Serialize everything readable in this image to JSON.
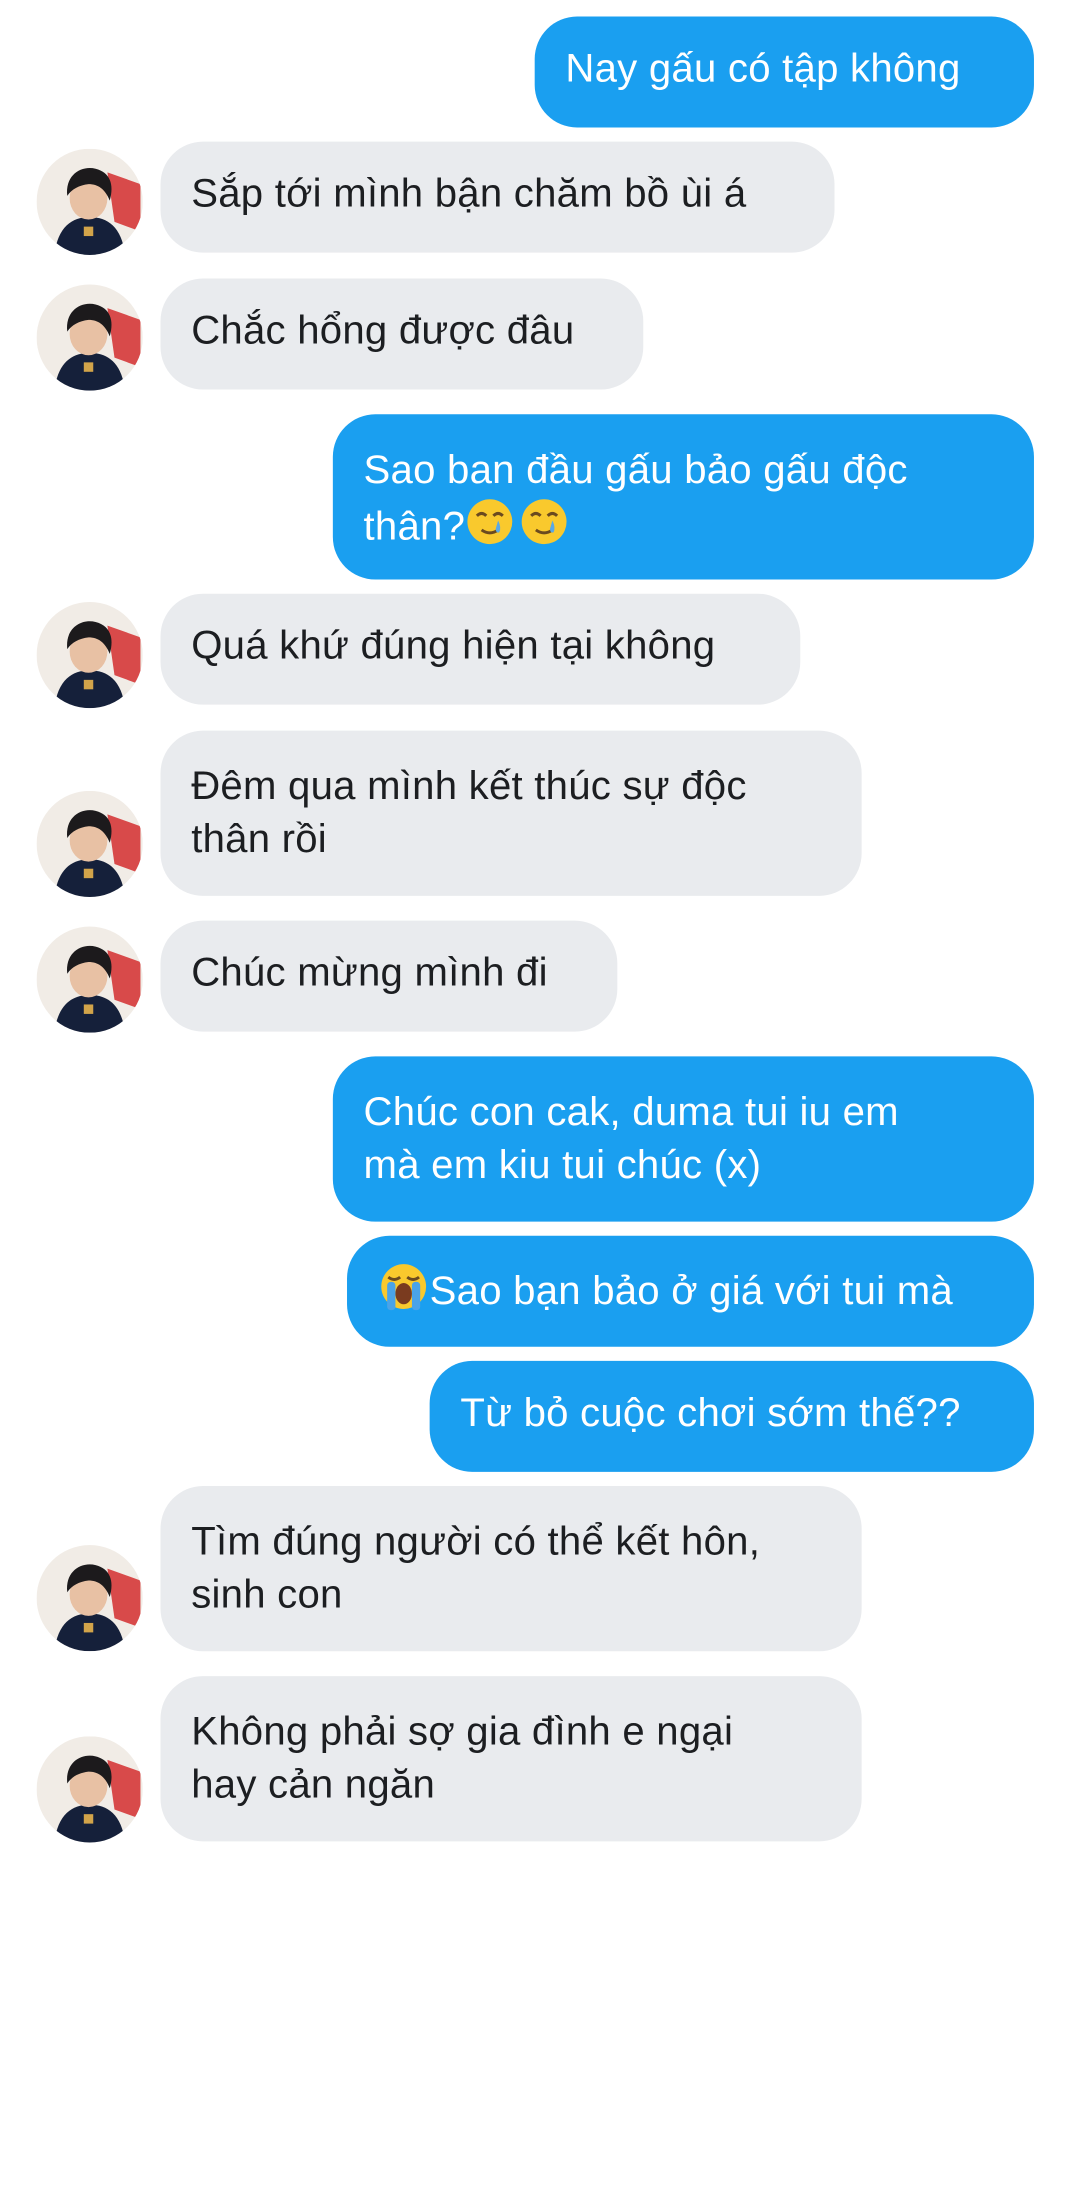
{
  "conversation": {
    "messages": [
      {
        "sender": "me",
        "lines": [
          "Nay gấu có tập không"
        ]
      },
      {
        "sender": "them",
        "lines": [
          "Sắp tới mình bận chăm bồ ùi á"
        ]
      },
      {
        "sender": "them",
        "lines": [
          "Chắc hổng được đâu"
        ]
      },
      {
        "sender": "me",
        "lines": [
          "Sao ban đầu gấu bảo gấu độc",
          "thân?"
        ],
        "emoji": "🥲🥲"
      },
      {
        "sender": "them",
        "lines": [
          "Quá khứ đúng hiện tại không"
        ]
      },
      {
        "sender": "them",
        "lines": [
          "Đêm qua mình kết thúc sự độc",
          "thân rồi"
        ]
      },
      {
        "sender": "them",
        "lines": [
          "Chúc mừng mình đi"
        ]
      },
      {
        "sender": "me",
        "lines": [
          "Chúc con cak, duma tui iu em",
          "mà em kiu tui chúc (x)"
        ]
      },
      {
        "sender": "me",
        "lines": [
          "Sao bạn bảo ở giá với tui mà"
        ],
        "emoji": "😭"
      },
      {
        "sender": "me",
        "lines": [
          "Từ bỏ cuộc chơi sớm thế??"
        ]
      },
      {
        "sender": "them",
        "lines": [
          "Tìm đúng người có thể kết hôn,",
          "sinh con"
        ]
      },
      {
        "sender": "them",
        "lines": [
          "Không phải sợ gia đình e ngại",
          "hay cản ngăn"
        ]
      }
    ]
  },
  "colors": {
    "outgoing_bubble": "#1a9ff0",
    "incoming_bubble": "#e9ebee",
    "outgoing_text": "#ffffff",
    "incoming_text": "#1c1e21"
  },
  "icons": {
    "avatar": "contact-avatar-photo",
    "emoji_1": "crying-smile-emoji",
    "emoji_2": "loudly-crying-emoji"
  }
}
